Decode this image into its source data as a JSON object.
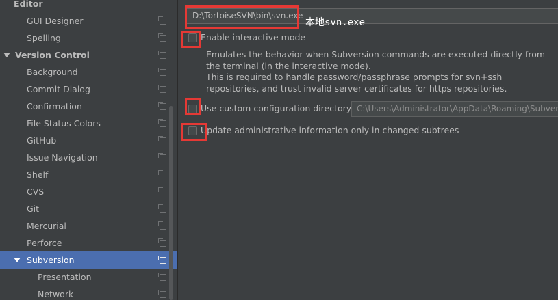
{
  "sidebar": {
    "items": [
      {
        "label": "Editor",
        "bold": true,
        "indent": 0,
        "arrow": false,
        "icon": false
      },
      {
        "label": "GUI Designer",
        "indent": 1,
        "icon": true
      },
      {
        "label": "Spelling",
        "indent": 1,
        "icon": true
      },
      {
        "label": "Version Control",
        "bold": true,
        "indent": 0,
        "arrow": true,
        "icon": true
      },
      {
        "label": "Background",
        "indent": 1,
        "icon": true
      },
      {
        "label": "Commit Dialog",
        "indent": 1,
        "icon": true
      },
      {
        "label": "Confirmation",
        "indent": 1,
        "icon": true
      },
      {
        "label": "File Status Colors",
        "indent": 1,
        "icon": true
      },
      {
        "label": "GitHub",
        "indent": 1,
        "icon": true
      },
      {
        "label": "Issue Navigation",
        "indent": 1,
        "icon": true
      },
      {
        "label": "Shelf",
        "indent": 1,
        "icon": true
      },
      {
        "label": "CVS",
        "indent": 1,
        "icon": true
      },
      {
        "label": "Git",
        "indent": 1,
        "icon": true
      },
      {
        "label": "Mercurial",
        "indent": 1,
        "icon": true
      },
      {
        "label": "Perforce",
        "indent": 1,
        "icon": true
      },
      {
        "label": "Subversion",
        "indent": 1,
        "arrow": true,
        "selected": true,
        "icon": true
      },
      {
        "label": "Presentation",
        "indent": 2,
        "icon": true
      },
      {
        "label": "Network",
        "indent": 2,
        "icon": true
      }
    ]
  },
  "main": {
    "svn_path": "D:\\TortoiseSVN\\bin\\svn.exe",
    "interactive_mode_label": "Enable interactive mode",
    "interactive_mode_checked": false,
    "description": [
      "Emulates the behavior when Subversion commands are executed directly from",
      "the terminal (in the interactive mode).",
      "This is required to handle password/passphrase prompts for svn+ssh",
      "repositories, and trust invalid server certificates for https repositories."
    ],
    "custom_config_label": "Use custom configuration directory:",
    "custom_config_checked": false,
    "custom_config_path": "C:\\Users\\Administrator\\AppData\\Roaming\\Subversion",
    "update_admin_label": "Update administrative information only in changed subtrees",
    "update_admin_checked": false
  },
  "annotation": {
    "note": "本地svn.exe",
    "color": "#e53935"
  },
  "colors": {
    "background": "#3c3f41",
    "selection": "#4b6eaf",
    "text": "#bbbbbb"
  }
}
